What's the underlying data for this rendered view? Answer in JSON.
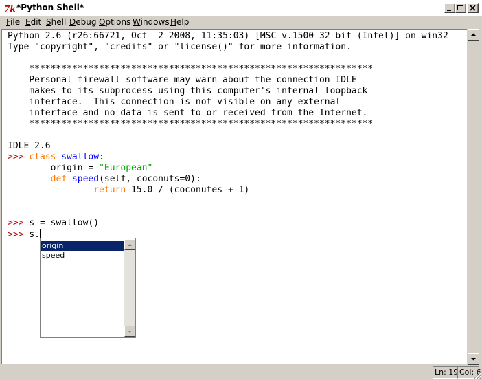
{
  "window": {
    "title": "*Python Shell*",
    "icon": "tk-feather-icon"
  },
  "menu": [
    {
      "accel": "F",
      "rest": "ile"
    },
    {
      "accel": "E",
      "rest": "dit"
    },
    {
      "accel": "S",
      "rest": "hell"
    },
    {
      "accel": "D",
      "rest": "ebug"
    },
    {
      "accel": "O",
      "rest": "ptions"
    },
    {
      "accel": "W",
      "rest": "indows"
    },
    {
      "accel": "H",
      "rest": "elp"
    }
  ],
  "shell": {
    "banner1": "Python 2.6 (r26:66721, Oct  2 2008, 11:35:03) [MSC v.1500 32 bit (Intel)] on win32",
    "banner2": "Type \"copyright\", \"credits\" or \"license()\" for more information.",
    "stars": "    ****************************************************************",
    "fw1": "    Personal firewall software may warn about the connection IDLE",
    "fw2": "    makes to its subprocess using this computer's internal loopback",
    "fw3": "    interface.  This connection is not visible on any external",
    "fw4": "    interface and no data is sent to or received from the Internet.",
    "idle_version": "IDLE 2.6",
    "prompt": ">>> ",
    "class_kw": "class",
    "class_name": "swallow",
    "class_colon": ":",
    "l2_indent": "        ",
    "l2_code": "origin = ",
    "l2_str": "\"European\"",
    "l3_indent": "        ",
    "def_kw": "def",
    "def_name": "speed",
    "def_rest": "(self, coconuts=0):",
    "l4_indent": "                ",
    "return_kw": "return",
    "return_rest": " 15.0 / (coconutes + 1)",
    "l5_code": "s = swallow()",
    "l6_code": "s."
  },
  "autocomplete": {
    "items": [
      "origin",
      "speed"
    ],
    "selected": "origin"
  },
  "status": {
    "line": "Ln: 19",
    "col": "Col: 6"
  }
}
